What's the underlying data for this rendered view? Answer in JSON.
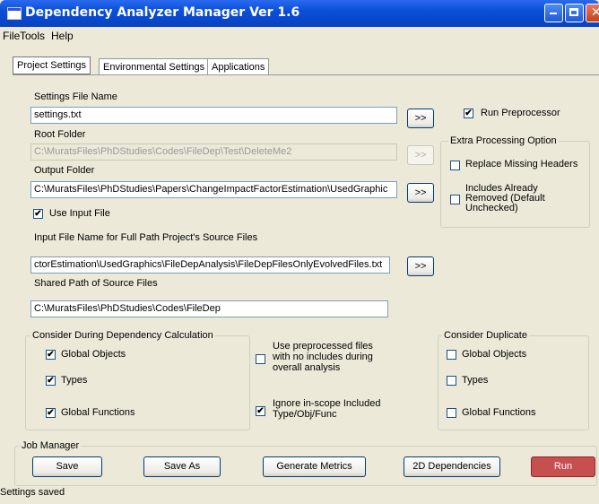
{
  "window": {
    "title": "Dependency Analyzer Manager Ver 1.6"
  },
  "menu": {
    "file": "File",
    "tools": "Tools",
    "help": "Help"
  },
  "tabs": [
    "Project Settings",
    "Environmental Settings",
    "Applications"
  ],
  "settings_file": {
    "label": "Settings File Name",
    "value": "settings.txt",
    "browse": ">>"
  },
  "root_folder": {
    "label": "Root Folder",
    "value": "C:\\MuratsFiles\\PhDStudies\\Codes\\FileDep\\Test\\DeleteMe2",
    "browse": ">>"
  },
  "output_folder": {
    "label": "Output Folder",
    "value": "C:\\MuratsFiles\\PhDStudies\\Papers\\ChangeImpactFactorEstimation\\UsedGraphic",
    "browse": ">>"
  },
  "use_input_file": {
    "label": "Use Input File",
    "checked": true
  },
  "input_file": {
    "label": "Input File Name for Full Path Project's Source Files",
    "value": "ctorEstimation\\UsedGraphics\\FileDepAnalysis\\FileDepFilesOnlyEvolvedFiles.txt",
    "browse": ">>"
  },
  "shared_path": {
    "label": "Shared Path of Source Files",
    "value": "C:\\MuratsFiles\\PhDStudies\\Codes\\FileDep"
  },
  "run_preprocessor": {
    "label": "Run Preprocessor",
    "checked": true
  },
  "extra_processing": {
    "title": "Extra Processing Option",
    "replace_missing": {
      "label": "Replace Missing Headers",
      "checked": false
    },
    "includes_removed": {
      "label1": "Includes Already",
      "label2": "Removed (Default",
      "label3": "Unchecked)",
      "checked": false
    }
  },
  "consider_calc": {
    "title": "Consider During Dependency Calculation",
    "global_objects": {
      "label": "Global Objects",
      "checked": true
    },
    "types": {
      "label": "Types",
      "checked": true
    },
    "global_functions": {
      "label": "Global Functions",
      "checked": true
    }
  },
  "use_preprocessed": {
    "label1": "Use preprocessed files",
    "label2": "with no includes during",
    "label3": "overall analysis",
    "checked": false
  },
  "ignore_inscope": {
    "label1": "Ignore in-scope Included",
    "label2": "Type/Obj/Func",
    "checked": true
  },
  "consider_duplicate": {
    "title": "Consider Duplicate",
    "global_objects": {
      "label": "Global Objects",
      "checked": false
    },
    "types": {
      "label": "Types",
      "checked": false
    },
    "global_functions": {
      "label": "Global Functions",
      "checked": false
    }
  },
  "job_manager": {
    "title": "Job Manager",
    "save": "Save",
    "save_as": "Save As",
    "generate_metrics": "Generate Metrics",
    "dependencies_2d": "2D Dependencies",
    "run": "Run"
  },
  "status": "Settings saved",
  "check_mark": "✔"
}
